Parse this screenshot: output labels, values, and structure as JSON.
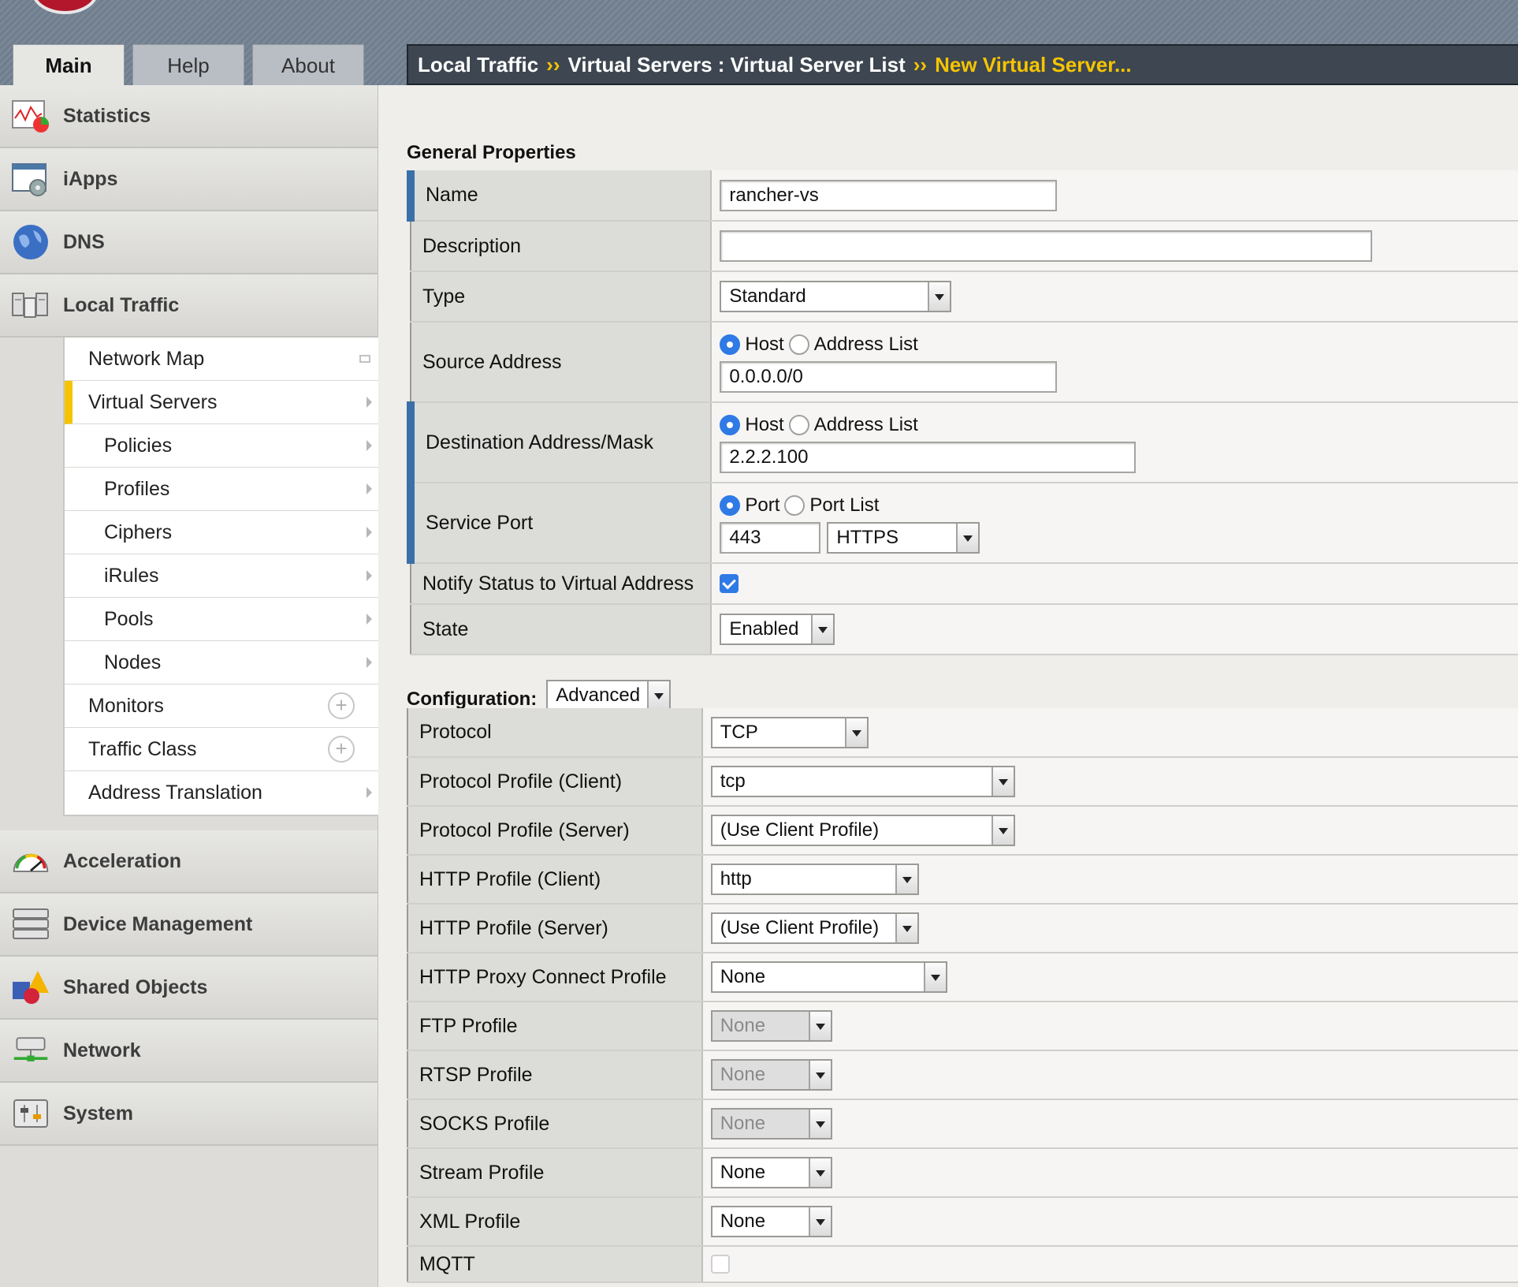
{
  "tabs": [
    "Main",
    "Help",
    "About"
  ],
  "breadcrumb": {
    "part1": "Local Traffic",
    "sep": "››",
    "part2": "Virtual Servers : Virtual Server List",
    "current": "New Virtual Server..."
  },
  "sidebar": {
    "categories_top": [
      {
        "label": "Statistics",
        "icon": "statistics-icon"
      },
      {
        "label": "iApps",
        "icon": "iapps-icon"
      },
      {
        "label": "DNS",
        "icon": "globe-icon"
      },
      {
        "label": "Local Traffic",
        "icon": "local-traffic-icon"
      }
    ],
    "local_traffic_items": [
      "Network Map",
      "Virtual Servers",
      "Policies",
      "Profiles",
      "Ciphers",
      "iRules",
      "Pools",
      "Nodes",
      "Monitors",
      "Traffic Class",
      "Address Translation"
    ],
    "categories_bottom": [
      {
        "label": "Acceleration",
        "icon": "speedometer-icon"
      },
      {
        "label": "Device Management",
        "icon": "servers-icon"
      },
      {
        "label": "Shared Objects",
        "icon": "shapes-icon"
      },
      {
        "label": "Network",
        "icon": "network-icon"
      },
      {
        "label": "System",
        "icon": "system-icon"
      }
    ]
  },
  "general": {
    "title": "General Properties",
    "name_label": "Name",
    "name_value": "rancher-vs",
    "description_label": "Description",
    "description_value": "",
    "type_label": "Type",
    "type_value": "Standard",
    "source_label": "Source Address",
    "host_label": "Host",
    "address_list_label": "Address List",
    "source_value": "0.0.0.0/0",
    "dest_label": "Destination Address/Mask",
    "dest_value": "2.2.2.100",
    "service_port_label": "Service Port",
    "port_label": "Port",
    "port_list_label": "Port List",
    "port_value": "443",
    "port_service": "HTTPS",
    "notify_label": "Notify Status to Virtual Address",
    "state_label": "State",
    "state_value": "Enabled"
  },
  "configuration": {
    "title": "Configuration:",
    "mode": "Advanced",
    "rows": [
      {
        "label": "Protocol",
        "value": "TCP",
        "disabled": false
      },
      {
        "label": "Protocol Profile (Client)",
        "value": "tcp",
        "disabled": false
      },
      {
        "label": "Protocol Profile (Server)",
        "value": "(Use Client Profile)",
        "disabled": false
      },
      {
        "label": "HTTP Profile (Client)",
        "value": "http",
        "disabled": false
      },
      {
        "label": "HTTP Profile (Server)",
        "value": "(Use Client Profile)",
        "disabled": false
      },
      {
        "label": "HTTP Proxy Connect Profile",
        "value": "None",
        "disabled": false
      },
      {
        "label": "FTP Profile",
        "value": "None",
        "disabled": true
      },
      {
        "label": "RTSP Profile",
        "value": "None",
        "disabled": true
      },
      {
        "label": "SOCKS Profile",
        "value": "None",
        "disabled": true
      },
      {
        "label": "Stream Profile",
        "value": "None",
        "disabled": false
      },
      {
        "label": "XML Profile",
        "value": "None",
        "disabled": false
      },
      {
        "label": "MQTT",
        "value": "",
        "disabled": false
      }
    ]
  },
  "colors": {
    "accent_yellow": "#f5c400",
    "required_bar": "#3b6fa7",
    "breadcrumb_bg": "#3d4651",
    "control_blue": "#2f7ae5"
  }
}
